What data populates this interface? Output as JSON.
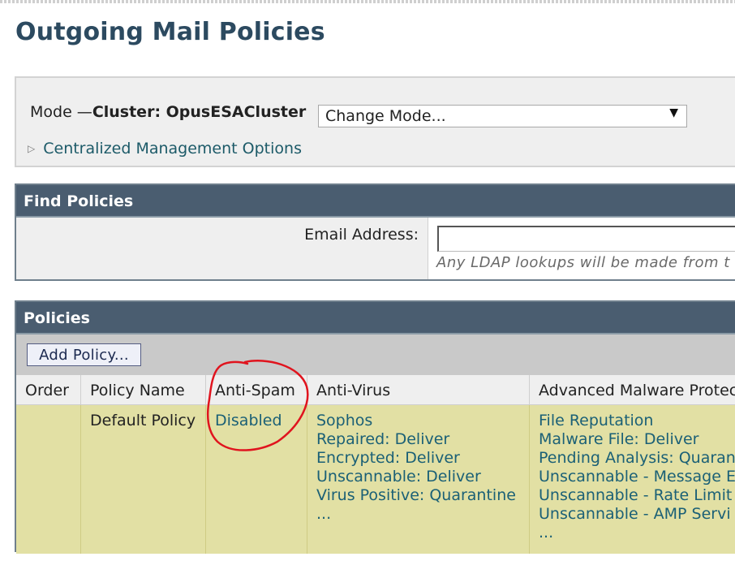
{
  "page": {
    "title": "Outgoing Mail Policies"
  },
  "mode": {
    "label": "Mode —",
    "cluster": "Cluster: OpusESACluster",
    "select_value": "Change Mode...",
    "centralized_options": "Centralized Management Options"
  },
  "find": {
    "header": "Find Policies",
    "email_label": "Email Address:",
    "email_value": "",
    "note": "Any LDAP lookups will be made from t"
  },
  "policies": {
    "header": "Policies",
    "add_button": "Add Policy...",
    "columns": [
      "Order",
      "Policy Name",
      "Anti-Spam",
      "Anti-Virus",
      "Advanced Malware Protec"
    ],
    "rows": [
      {
        "order": "",
        "name": "Default Policy",
        "anti_spam": "Disabled",
        "anti_virus": [
          "Sophos",
          "Repaired: Deliver",
          "Encrypted: Deliver",
          "Unscannable: Deliver",
          "Virus Positive: Quarantine",
          "..."
        ],
        "amp": [
          "File Reputation",
          "Malware File: Deliver",
          "Pending Analysis: Quaran",
          "Unscannable - Message E",
          "Unscannable - Rate Limit",
          "Unscannable - AMP Servi",
          "..."
        ]
      }
    ]
  },
  "colors": {
    "title": "#2c4a60",
    "header_bg": "#4a5d70",
    "row_bg": "#e2e0a4",
    "link": "#1b6076",
    "annotation": "#e0141e"
  }
}
